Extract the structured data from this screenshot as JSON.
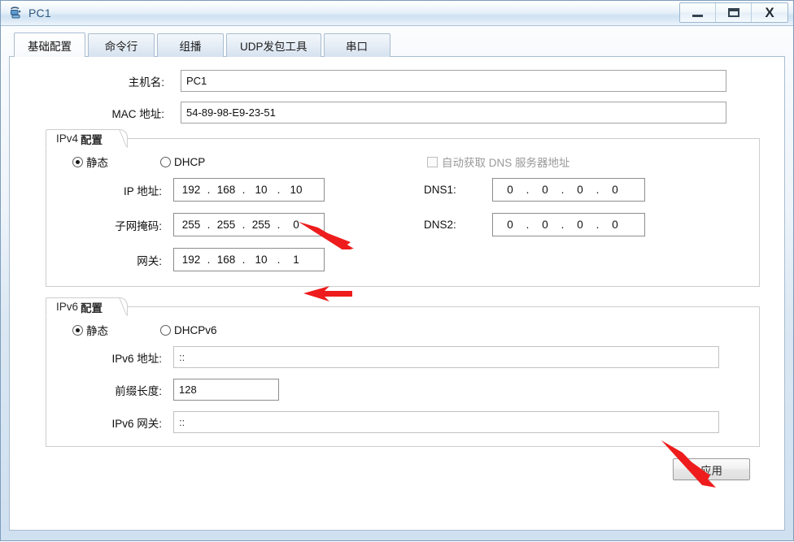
{
  "window": {
    "title": "PC1",
    "icon": "pc-device-icon",
    "controls": {
      "minimize": "minimize-icon",
      "maximize": "maximize-icon",
      "close": "X"
    }
  },
  "tabs": [
    {
      "label": "基础配置",
      "active": true
    },
    {
      "label": "命令行",
      "active": false
    },
    {
      "label": "组播",
      "active": false
    },
    {
      "label": "UDP发包工具",
      "active": false
    },
    {
      "label": "串口",
      "active": false
    }
  ],
  "basic": {
    "hostname_label": "主机名:",
    "hostname_value": "PC1",
    "mac_label": "MAC 地址:",
    "mac_value": "54-89-98-E9-23-51"
  },
  "ipv4": {
    "legend_prefix": "IPv4",
    "legend_bold": "配置",
    "radio_static": "静态",
    "radio_dhcp": "DHCP",
    "static_selected": true,
    "dns_auto_label": "自动获取 DNS 服务器地址",
    "dns_auto_checked": false,
    "ip_label": "IP 地址:",
    "ip_octets": [
      "192",
      "168",
      "10",
      "10"
    ],
    "mask_label": "子网掩码:",
    "mask_octets": [
      "255",
      "255",
      "255",
      "0"
    ],
    "gw_label": "网关:",
    "gw_octets": [
      "192",
      "168",
      "10",
      "1"
    ],
    "dns1_label": "DNS1:",
    "dns1_octets": [
      "0",
      "0",
      "0",
      "0"
    ],
    "dns2_label": "DNS2:",
    "dns2_octets": [
      "0",
      "0",
      "0",
      "0"
    ],
    "separator": "."
  },
  "ipv6": {
    "legend_prefix": "IPv6",
    "legend_bold": "配置",
    "radio_static": "静态",
    "radio_dhcpv6": "DHCPv6",
    "static_selected": true,
    "addr_label": "IPv6 地址:",
    "addr_value": "::",
    "prefix_label": "前缀长度:",
    "prefix_value": "128",
    "gw_label": "IPv6 网关:",
    "gw_value": "::"
  },
  "footer": {
    "apply_label": "应用"
  },
  "annotations": {
    "arrow_color": "#ee1c1c",
    "arrows": [
      {
        "name": "arrow-to-ip-address",
        "points_to": "ip_address_field"
      },
      {
        "name": "arrow-to-gateway",
        "points_to": "gateway_field"
      },
      {
        "name": "arrow-to-apply",
        "points_to": "apply_button"
      }
    ]
  }
}
